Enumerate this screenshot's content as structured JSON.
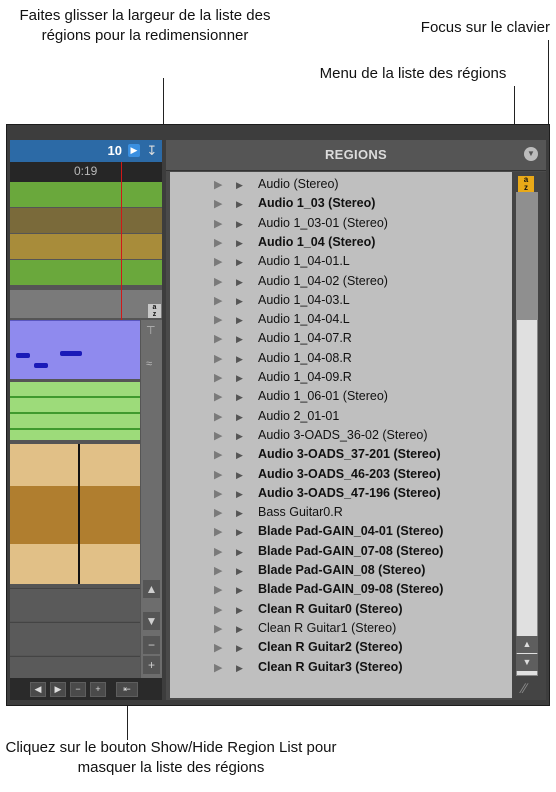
{
  "callouts": {
    "resize_region_list": "Faites glisser la largeur de la liste des régions pour la redimensionner",
    "keyboard_focus": "Focus sur le clavier",
    "region_list_menu": "Menu de la liste des régions",
    "show_hide_button": "Cliquez sur le bouton Show/Hide Region List pour masquer la liste des régions"
  },
  "edit_window": {
    "counter_value": "10",
    "time_value": "0:19",
    "az_label": "a z",
    "counter_icon": "play-arrow-icon",
    "down_icon": "down-arrow-icon"
  },
  "region_list": {
    "title": "REGIONS",
    "menu_icon": "chevron-down-icon",
    "keyboard_focus_badge": "a z",
    "items": [
      {
        "label": "Audio (Stereo)",
        "bold": false
      },
      {
        "label": "Audio 1_03 (Stereo)",
        "bold": true
      },
      {
        "label": "Audio 1_03-01 (Stereo)",
        "bold": false
      },
      {
        "label": "Audio 1_04 (Stereo)",
        "bold": true
      },
      {
        "label": "Audio 1_04-01.L",
        "bold": false
      },
      {
        "label": "Audio 1_04-02 (Stereo)",
        "bold": false
      },
      {
        "label": "Audio 1_04-03.L",
        "bold": false
      },
      {
        "label": "Audio 1_04-04.L",
        "bold": false
      },
      {
        "label": "Audio 1_04-07.R",
        "bold": false
      },
      {
        "label": "Audio 1_04-08.R",
        "bold": false
      },
      {
        "label": "Audio 1_04-09.R",
        "bold": false
      },
      {
        "label": "Audio 1_06-01 (Stereo)",
        "bold": false
      },
      {
        "label": "Audio 2_01-01",
        "bold": false
      },
      {
        "label": "Audio 3-OADS_36-02 (Stereo)",
        "bold": false
      },
      {
        "label": "Audio 3-OADS_37-201 (Stereo)",
        "bold": true
      },
      {
        "label": "Audio 3-OADS_46-203 (Stereo)",
        "bold": true
      },
      {
        "label": "Audio 3-OADS_47-196 (Stereo)",
        "bold": true
      },
      {
        "label": "Bass Guitar0.R",
        "bold": false
      },
      {
        "label": "Blade Pad-GAIN_04-01 (Stereo)",
        "bold": true
      },
      {
        "label": "Blade Pad-GAIN_07-08 (Stereo)",
        "bold": true
      },
      {
        "label": "Blade Pad-GAIN_08 (Stereo)",
        "bold": true
      },
      {
        "label": "Blade Pad-GAIN_09-08 (Stereo)",
        "bold": true
      },
      {
        "label": "Clean R Guitar0 (Stereo)",
        "bold": true
      },
      {
        "label": "Clean R Guitar1 (Stereo)",
        "bold": false
      },
      {
        "label": "Clean R Guitar2 (Stereo)",
        "bold": true
      },
      {
        "label": "Clean R Guitar3 (Stereo)",
        "bold": true
      }
    ]
  },
  "colors": {
    "counter_blue": "#2c6aa6",
    "playhead_red": "#d01818",
    "midi_purple": "#8f8aee",
    "audio_green": "#6aa83c",
    "wave_tan": "#e1c087",
    "focus_badge": "#e9a918",
    "list_bg": "#bfbfbf"
  }
}
